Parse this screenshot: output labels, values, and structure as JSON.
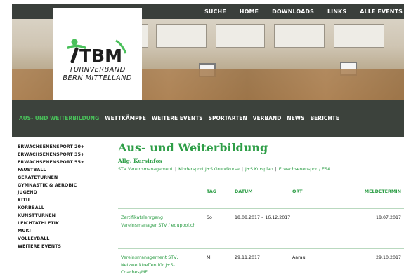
{
  "top_nav": [
    "SUCHE",
    "HOME",
    "DOWNLOADS",
    "LINKS",
    "ALLE EVENTS"
  ],
  "logo": {
    "mark": "TBM",
    "line1": "TURNVERBAND",
    "line2": "BERN MITTELLAND"
  },
  "colors": {
    "accent": "#2e9e47",
    "nav_bg": "#3c423c",
    "nav_active": "#49c05a"
  },
  "main_nav": [
    {
      "label": "AUS- UND WEITERBILDUNG",
      "active": true
    },
    {
      "label": "WETTKÄMPFE"
    },
    {
      "label": "WEITERE EVENTS"
    },
    {
      "label": "SPORTARTEN"
    },
    {
      "label": "VERBAND"
    },
    {
      "label": "NEWS"
    },
    {
      "label": "BERICHTE"
    }
  ],
  "sidebar": [
    "ERWACHSENENSPORT 20+",
    "ERWACHSENENSPORT 35+",
    "ERWACHSENENSPORT 55+",
    "FAUSTBALL",
    "GERÄTETURNEN",
    "GYMNASTIK & AEROBIC",
    "JUGEND",
    "KITU",
    "KORBBALL",
    "KUNSTTURNEN",
    "LEICHTATHLETIK",
    "MUKI",
    "VOLLEYBALL",
    "WEITERE EVENTS"
  ],
  "content": {
    "title": "Aus- und Weiterbildung",
    "subtitle": "Allg. Kursinfos",
    "links": [
      "STV Vereinsmanagement",
      "Kindersport J+S Grundkurse",
      "J+S Kursplan",
      "Erwachsenensport/ ESA"
    ]
  },
  "table": {
    "headers": {
      "tag": "TAG",
      "datum": "DATUM",
      "ort": "ORT",
      "meldetermin": "MELDETERMIN"
    },
    "rows": [
      {
        "kurs": "Zertifikatslehrgang Vereinsmanager STV / edupool.ch",
        "tag": "So",
        "datum": "18.08.2017 – 16.12.2017",
        "ort": "",
        "meldetermin": "18.07.2017"
      },
      {
        "kurs": "Vereinsmanagement STV, Netzwerktreffen für J+S-Coaches/MF",
        "tag": "Mi",
        "datum": "29.11.2017",
        "ort": "Aarau",
        "meldetermin": "29.10.2017"
      }
    ]
  }
}
